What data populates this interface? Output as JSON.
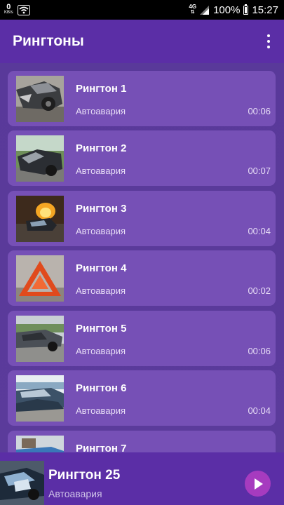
{
  "status_bar": {
    "kbs_value": "0",
    "kbs_unit": "KB/s",
    "network": "4G",
    "battery": "100%",
    "time": "15:27"
  },
  "app_bar": {
    "title": "Рингтоны"
  },
  "ringtones": [
    {
      "name": "Рингтон 1",
      "category": "Автоавария",
      "duration": "00:06"
    },
    {
      "name": "Рингтон 2",
      "category": "Автоавария",
      "duration": "00:07"
    },
    {
      "name": "Рингтон 3",
      "category": "Автоавария",
      "duration": "00:04"
    },
    {
      "name": "Рингтон 4",
      "category": "Автоавария",
      "duration": "00:02"
    },
    {
      "name": "Рингтон 5",
      "category": "Автоавария",
      "duration": "00:06"
    },
    {
      "name": "Рингтон 6",
      "category": "Автоавария",
      "duration": "00:04"
    },
    {
      "name": "Рингтон 7",
      "category": "",
      "duration": ""
    }
  ],
  "player": {
    "title": "Рингтон 25",
    "category": "Автоавария"
  },
  "colors": {
    "app_bar": "#5b2ea6",
    "card": "#7650b6",
    "list_bg": "#5a3a9a",
    "play_button": "#a63bbf"
  }
}
